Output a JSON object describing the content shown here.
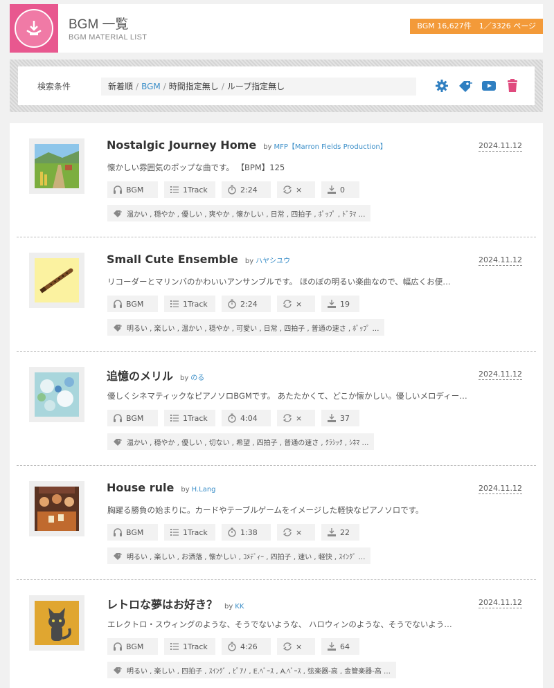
{
  "header": {
    "title": "BGM 一覧",
    "subtitle": "BGM MATERIAL LIST",
    "count": "BGM 16,627件　1／3326 ページ"
  },
  "search": {
    "label": "検索条件",
    "conditions": {
      "sort": "新着順",
      "category": "BGM",
      "time": "時間指定無し",
      "loop": "ループ指定無し"
    },
    "separator": "/"
  },
  "colors": {
    "accent_orange": "#f39a39",
    "brand_pink": "#e8588f",
    "link_blue": "#3a8ec8",
    "icon_blue": "#2f7fc1",
    "trash_pink": "#e04a7e"
  },
  "icons": [
    "gear-icon",
    "tag-icon",
    "video-icon",
    "trash-icon",
    "headphones-icon",
    "list-icon",
    "stopwatch-icon",
    "loop-icon",
    "download-icon"
  ],
  "items": [
    {
      "title": "Nostalgic Journey Home",
      "by": "by",
      "author": "MFP【Marron Fields Production】",
      "date": "2024.11.12",
      "desc": "懐かしい雰囲気のポップな曲です。 【BPM】125",
      "genre": "BGM",
      "tracks": "1Track",
      "duration": "2:24",
      "loop": "×",
      "downloads": "0",
      "tags": "温かい , 穏やか , 優しい , 爽やか , 懐かしい , 日常 , 四拍子 , ﾎﾟｯﾌﾟ , ﾄﾞﾗﾏ …",
      "thumb": "village"
    },
    {
      "title": "Small Cute Ensemble",
      "by": "by",
      "author": "ハヤシユウ",
      "date": "2024.11.12",
      "desc": "リコーダーとマリンバのかわいいアンサンブルです。 ほのぼの明るい楽曲なので、幅広くお便…",
      "genre": "BGM",
      "tracks": "1Track",
      "duration": "2:24",
      "loop": "×",
      "downloads": "19",
      "tags": "明るい , 楽しい , 温かい , 穏やか , 可愛い , 日常 , 四拍子 , 普通の速さ , ﾎﾟｯﾌﾟ …",
      "thumb": "recorder"
    },
    {
      "title": "追憶のメリル",
      "by": "by",
      "author": "のる",
      "date": "2024.11.12",
      "desc": "優しくシネマティックなピアノソロBGMです。 あたたかくて、どこか懐かしい。優しいメロディー…",
      "genre": "BGM",
      "tracks": "1Track",
      "duration": "4:04",
      "loop": "×",
      "downloads": "37",
      "tags": "温かい , 穏やか , 優しい , 切ない , 希望 , 四拍子 , 普通の速さ , ｸﾗｼｯｸ , ｼﾈﾏ …",
      "thumb": "flowers"
    },
    {
      "title": "House rule",
      "by": "by",
      "author": "H.Lang",
      "date": "2024.11.12",
      "desc": "胸躍る勝負の始まりに。カードやテーブルゲームをイメージした軽快なピアノソロです。",
      "genre": "BGM",
      "tracks": "1Track",
      "duration": "1:38",
      "loop": "×",
      "downloads": "22",
      "tags": "明るい , 楽しい , お洒落 , 懐かしい , ｺﾒﾃﾞｨｰ , 四拍子 , 速い , 軽快 , ｽｲﾝｸﾞ …",
      "thumb": "table"
    },
    {
      "title": "レトロな夢はお好き？",
      "by": "by",
      "author": "KK",
      "date": "2024.11.12",
      "desc": "エレクトロ・スウィングのような、そうでないような、 ハロウィンのような、そうでないよう…",
      "genre": "BGM",
      "tracks": "1Track",
      "duration": "4:26",
      "loop": "×",
      "downloads": "64",
      "tags": "明るい , 楽しい , 四拍子 , ｽｲﾝｸﾞ , ﾋﾟｱﾉ , E.ﾍﾞｰｽ , A.ﾍﾞｰｽ , 弦楽器-高 , 金管楽器-高 …",
      "thumb": "cat"
    }
  ]
}
